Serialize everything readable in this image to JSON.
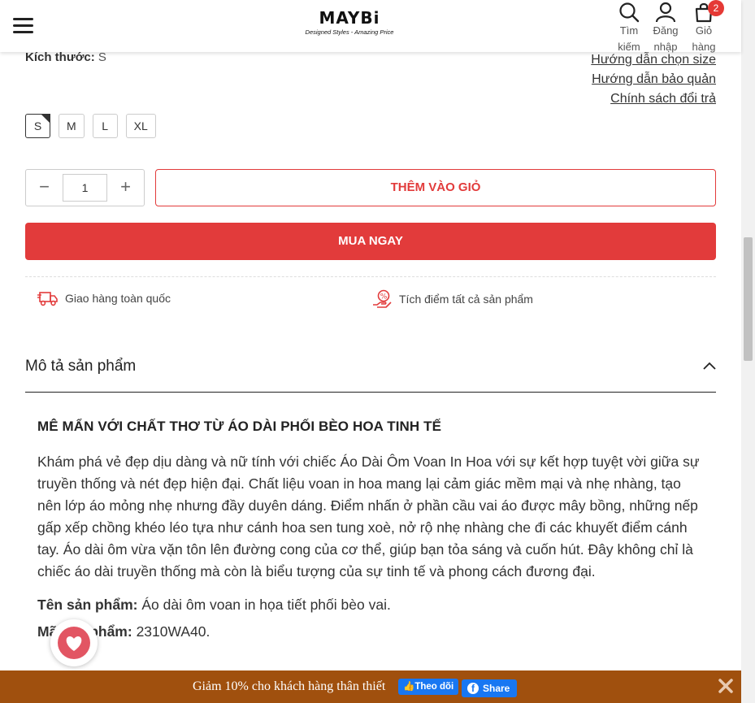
{
  "header": {
    "logo_name": "MAYBi",
    "logo_tagline": "Designed Styles - Amazing Price",
    "search_label": "Tìm kiếm",
    "login_label": "Đăng nhập",
    "cart_label": "Giỏ hàng",
    "cart_count": "2"
  },
  "size": {
    "label": "Kích thước:",
    "selected": "S",
    "options": [
      "S",
      "M",
      "L",
      "XL"
    ]
  },
  "links": {
    "size_guide": "Hướng dẫn chọn size",
    "care_guide": "Hướng dẫn bảo quản",
    "return_policy": "Chính sách đổi trả"
  },
  "quantity": {
    "value": "1",
    "minus": "−",
    "plus": "+"
  },
  "buttons": {
    "add_to_cart": "THÊM VÀO GIỎ",
    "buy_now": "MUA NGAY"
  },
  "features": {
    "shipping": "Giao hàng toàn quốc",
    "points": "Tích điểm tất cả sản phẩm"
  },
  "description": {
    "section_title": "Mô tả sản phẩm",
    "heading": "MÊ MẨN VỚI CHẤT THƠ TỪ ÁO DÀI PHỐI BÈO HOA TINH TẾ",
    "paragraph": "Khám phá vẻ đẹp dịu dàng và nữ tính với chiếc Áo Dài Ôm Voan In Hoa với sự kết hợp tuyệt vời giữa sự truyền thống và nét đẹp hiện đại. Chất liệu voan in hoa mang lại cảm giác mềm mại và nhẹ nhàng, tạo nên lớp áo mỏng nhẹ nhưng đầy duyên dáng. Điểm nhấn ở phần cầu vai áo được mây bồng, những nếp gấp xếp chồng khéo léo tựa như cánh hoa sen tung xoè, nở rộ nhẹ nhàng che đi các khuyết điểm cánh tay. Áo dài ôm vừa vặn tôn lên đường cong của cơ thể, giúp bạn tỏa sáng và cuốn hút. Đây không chỉ là chiếc áo dài truyền thống mà còn là biểu tượng của sự tinh tế và phong cách đương đại.",
    "name_label": "Tên sản phẩm:",
    "name_value": " Áo dài ôm voan in họa tiết phối bèo vai.",
    "code_label": "Mã sản phẩm:",
    "code_value": " 2310WA40."
  },
  "promo_bar": {
    "text": "Giảm 10% cho khách hàng thân thiết",
    "follow_label": "Theo dõi",
    "share_label": "Share"
  },
  "colors": {
    "accent": "#e23b3b",
    "promo_bg": "#a0500e",
    "facebook": "#1877f2"
  },
  "icons": [
    "menu-icon",
    "search-icon",
    "user-icon",
    "cart-icon",
    "truck-icon",
    "reward-icon",
    "chevron-up-icon",
    "heart-icon",
    "thumbs-up-icon",
    "facebook-icon",
    "close-icon"
  ]
}
